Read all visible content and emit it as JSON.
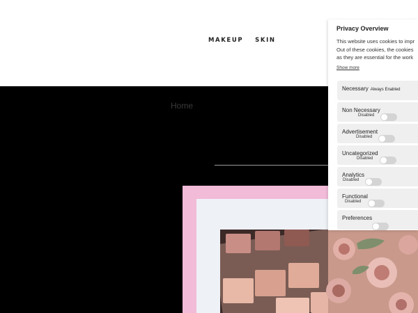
{
  "nav": {
    "items": [
      "MAKEUP",
      "SKIN"
    ]
  },
  "hero": {
    "breadcrumb_home": "Home"
  },
  "privacy": {
    "title": "Privacy Overview",
    "text_lines": [
      "This website uses cookies to impr",
      "Out of these cookies, the cookies",
      "as they are essential for the work"
    ],
    "show_more": "Show more",
    "categories": [
      {
        "name": "Necessary",
        "status": "Always Enabled"
      },
      {
        "name": "Non Necessary",
        "status": "Disabled"
      },
      {
        "name": "Advertisement",
        "status": "Disabled"
      },
      {
        "name": "Uncategorized",
        "status": "Disabled"
      },
      {
        "name": "Analytics",
        "status": "Disabled"
      },
      {
        "name": "Functional",
        "status": "Disabled"
      },
      {
        "name": "Preferences",
        "status": ""
      }
    ]
  },
  "colors": {
    "hero_background": "#000000",
    "frame_pink": "#f2bcd9",
    "toggle_off": "#d4d4d4"
  }
}
